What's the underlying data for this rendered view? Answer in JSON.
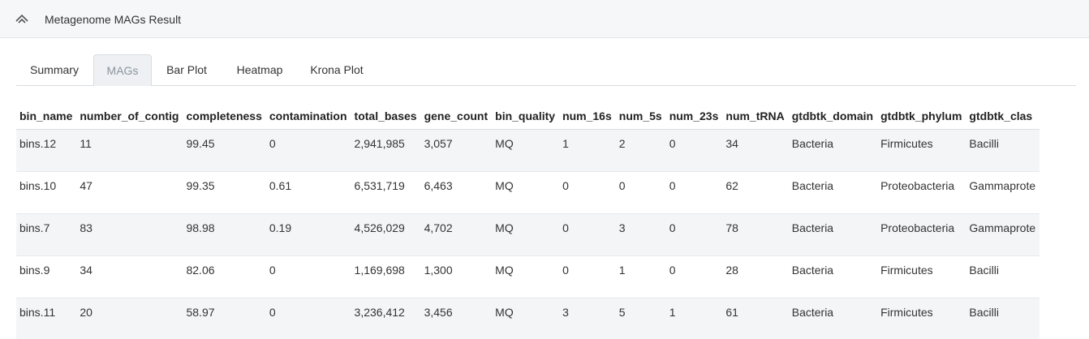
{
  "header": {
    "title": "Metagenome MAGs Result"
  },
  "tabs": [
    {
      "label": "Summary"
    },
    {
      "label": "MAGs"
    },
    {
      "label": "Bar Plot"
    },
    {
      "label": "Heatmap"
    },
    {
      "label": "Krona Plot"
    }
  ],
  "table": {
    "columns": [
      "bin_name",
      "number_of_contig",
      "completeness",
      "contamination",
      "total_bases",
      "gene_count",
      "bin_quality",
      "num_16s",
      "num_5s",
      "num_23s",
      "num_tRNA",
      "gtdbtk_domain",
      "gtdbtk_phylum",
      "gtdbtk_clas"
    ],
    "rows": [
      [
        "bins.12",
        "11",
        "99.45",
        "0",
        "2,941,985",
        "3,057",
        "MQ",
        "1",
        "2",
        "0",
        "34",
        "Bacteria",
        "Firmicutes",
        "Bacilli"
      ],
      [
        "bins.10",
        "47",
        "99.35",
        "0.61",
        "6,531,719",
        "6,463",
        "MQ",
        "0",
        "0",
        "0",
        "62",
        "Bacteria",
        "Proteobacteria",
        "Gammaprote"
      ],
      [
        "bins.7",
        "83",
        "98.98",
        "0.19",
        "4,526,029",
        "4,702",
        "MQ",
        "0",
        "3",
        "0",
        "78",
        "Bacteria",
        "Proteobacteria",
        "Gammaprote"
      ],
      [
        "bins.9",
        "34",
        "82.06",
        "0",
        "1,169,698",
        "1,300",
        "MQ",
        "0",
        "1",
        "0",
        "28",
        "Bacteria",
        "Firmicutes",
        "Bacilli"
      ],
      [
        "bins.11",
        "20",
        "58.97",
        "0",
        "3,236,412",
        "3,456",
        "MQ",
        "3",
        "5",
        "1",
        "61",
        "Bacteria",
        "Firmicutes",
        "Bacilli"
      ]
    ]
  }
}
